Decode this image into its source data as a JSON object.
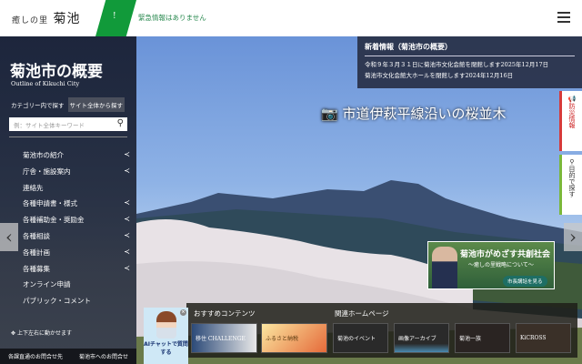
{
  "header": {
    "logo_small": "癒しの里",
    "logo_main": "菊池",
    "alert_icon": "!",
    "alert_text": "緊急情報はありません",
    "menu_icon": "hamburger-icon"
  },
  "sidebar": {
    "title": "菊池市の概要",
    "subtitle": "Outline of Kikuchi City",
    "tab_category": "カテゴリー内で探す",
    "tab_site": "サイト全体から探す",
    "search_placeholder": "例：サイト全体キーワード",
    "items": [
      {
        "label": "菊池市の紹介",
        "share": true
      },
      {
        "label": "庁舎・施設案内",
        "share": true
      },
      {
        "label": "連絡先",
        "share": false
      },
      {
        "label": "各種申請書・様式",
        "share": true
      },
      {
        "label": "各種補助金・奨励金",
        "share": true
      },
      {
        "label": "各種相談",
        "share": true
      },
      {
        "label": "各種計画",
        "share": true
      },
      {
        "label": "各種募集",
        "share": true
      },
      {
        "label": "オンライン申請",
        "share": false
      },
      {
        "label": "パブリック・コメント",
        "share": false
      }
    ],
    "move_hint": "上下左右に動かせます",
    "footer_links": [
      "各課直通のお問合せ先",
      "菊池市へのお問合せ"
    ]
  },
  "news": {
    "title": "新着情報（菊池市の概要）",
    "items": [
      "令和９年３月３１日に菊池市文化会館を閉館します2025年12月17日",
      "菊池市文化会館大ホールを閉館します2024年12月16日"
    ]
  },
  "hero": {
    "caption": "市道伊萩平線沿いの桜並木"
  },
  "right_tabs": {
    "disaster": "防災情報",
    "purpose": "目的で探す"
  },
  "banner": {
    "title": "菊池市がめざす共創社会",
    "subtitle": "～癒しの里戦略について～",
    "button": "市長講話を見る"
  },
  "bottom": {
    "recommended_title": "おすすめコンテンツ",
    "recommended": [
      "移住 CHALLENGE",
      "ふるさと納税"
    ],
    "related_title": "関連ホームページ",
    "related": [
      "菊池のイベント",
      "画像アーカイブ",
      "菊池一族",
      "KiCROSS"
    ]
  },
  "ai_chat": {
    "label": "AIチャットで質問する"
  },
  "colors": {
    "brand_green": "#119a3a",
    "sidebar": "#1c2234",
    "disaster_red": "#d63a3a"
  }
}
